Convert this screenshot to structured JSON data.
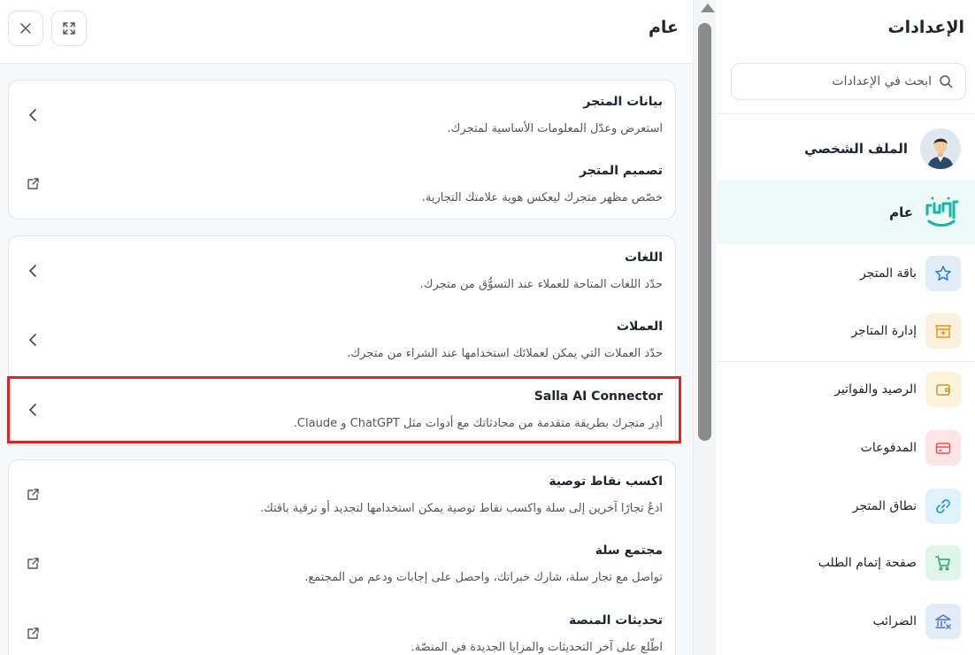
{
  "sidebar": {
    "title": "الإعدادات",
    "search_placeholder": "ابحث في الإعدادات",
    "profile_label": "الملف الشخصي",
    "items": [
      {
        "label": "عام",
        "icon": "store-logo-icon",
        "color": "#13b9a6",
        "bg": "#ffffff"
      },
      {
        "label": "باقة المتجر",
        "icon": "star-icon",
        "color": "#2d7fc9",
        "bg": "#e2edf7"
      },
      {
        "label": "إدارة المتاجر",
        "icon": "store-manage-icon",
        "color": "#e8961c",
        "bg": "#fdf0dc"
      },
      {
        "label": "الرصيد والفواتير",
        "icon": "wallet-icon",
        "color": "#c79a1b",
        "bg": "#fbf3dc"
      },
      {
        "label": "المدفوعات",
        "icon": "card-icon",
        "color": "#e25555",
        "bg": "#fde5e5"
      },
      {
        "label": "نطاق المتجر",
        "icon": "link-icon",
        "color": "#1d9bc2",
        "bg": "#dff3fa"
      },
      {
        "label": "صفحة إتمام الطلب",
        "icon": "cart-icon",
        "color": "#1fa86a",
        "bg": "#e0f5ea"
      },
      {
        "label": "الضرائب",
        "icon": "tax-icon",
        "color": "#4c78c8",
        "bg": "#e4ecf8"
      }
    ]
  },
  "panel": {
    "title": "عام",
    "cards": [
      {
        "rows": [
          {
            "title": "بيانات المتجر",
            "desc": "استعرض وعدّل المعلومات الأساسية لمتجرك.",
            "action": "chevron"
          },
          {
            "title": "تصميم المتجر",
            "desc": "خصّص مظهر متجرك ليعكس هوية علامتك التجارية.",
            "action": "external"
          }
        ]
      },
      {
        "rows": [
          {
            "title": "اللغات",
            "desc": "حدّد اللغات المتاحة للعملاء عند التسوُّق من متجرك.",
            "action": "chevron"
          },
          {
            "title": "العملات",
            "desc": "حدّد العملات التي يمكن لعملائك استخدامها عند الشراء من متجرك.",
            "action": "chevron"
          },
          {
            "title": "Salla AI Connector",
            "desc": "أدِر متجرك بطريقة متقدمة من محادثاتك مع أدوات مثل ChatGPT و Claude.",
            "action": "chevron"
          }
        ]
      },
      {
        "rows": [
          {
            "title": "اكسب نقاط توصية",
            "desc": "ادعُ تجارًا آخرين إلى سلة واكسب نقاط توصية يمكن استخدامها لتجديد أو ترقية باقتك.",
            "action": "external"
          },
          {
            "title": "مجتمع سلة",
            "desc": "تواصل مع تجار سلة، شارك خبراتك، واحصل على إجابات ودعم من المجتمع.",
            "action": "external"
          },
          {
            "title": "تحديثات المنصة",
            "desc": "اطّلع على آخر التحديثات والمزايا الجديدة في المنصّة.",
            "action": "external"
          }
        ]
      }
    ]
  }
}
